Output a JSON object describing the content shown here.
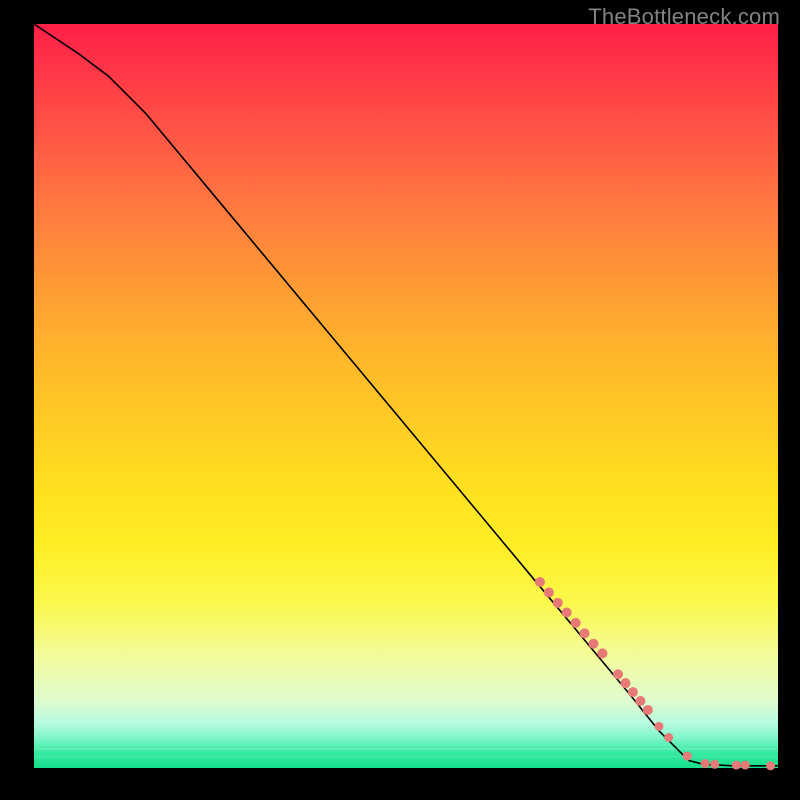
{
  "attribution": "TheBottleneck.com",
  "chart_data": {
    "type": "line",
    "title": "",
    "xlabel": "",
    "ylabel": "",
    "xlim": [
      0,
      100
    ],
    "ylim": [
      0,
      100
    ],
    "grid": false,
    "curve": {
      "name": "bottleneck-curve",
      "x": [
        0,
        3,
        6,
        10,
        15,
        20,
        25,
        30,
        35,
        40,
        45,
        50,
        55,
        60,
        65,
        70,
        75,
        80,
        84,
        88,
        90,
        92,
        94,
        96,
        98,
        100
      ],
      "y": [
        100,
        98,
        96,
        93,
        88,
        82,
        76,
        70,
        64,
        58,
        52,
        46,
        40,
        34,
        28,
        22,
        16,
        10,
        5,
        1,
        0.5,
        0.4,
        0.3,
        0.3,
        0.3,
        0.3
      ]
    },
    "marker_groups": [
      {
        "name": "highlight-segment-upper",
        "radius": 5.0,
        "points": [
          {
            "x": 68.0,
            "y": 25.0
          },
          {
            "x": 69.2,
            "y": 23.6
          },
          {
            "x": 70.4,
            "y": 22.2
          },
          {
            "x": 71.6,
            "y": 20.9
          },
          {
            "x": 72.8,
            "y": 19.5
          },
          {
            "x": 74.0,
            "y": 18.1
          },
          {
            "x": 75.2,
            "y": 16.7
          },
          {
            "x": 76.4,
            "y": 15.4
          }
        ]
      },
      {
        "name": "highlight-segment-lower",
        "radius": 5.0,
        "points": [
          {
            "x": 78.5,
            "y": 12.6
          },
          {
            "x": 79.5,
            "y": 11.4
          },
          {
            "x": 80.5,
            "y": 10.2
          },
          {
            "x": 81.5,
            "y": 9.0
          },
          {
            "x": 82.5,
            "y": 7.8
          }
        ]
      },
      {
        "name": "highlight-points-tail",
        "radius": 4.5,
        "points": [
          {
            "x": 84.0,
            "y": 5.6
          },
          {
            "x": 85.3,
            "y": 4.1
          },
          {
            "x": 87.8,
            "y": 1.6
          },
          {
            "x": 90.2,
            "y": 0.6
          },
          {
            "x": 91.5,
            "y": 0.5
          },
          {
            "x": 94.4,
            "y": 0.4
          },
          {
            "x": 95.6,
            "y": 0.4
          },
          {
            "x": 99.0,
            "y": 0.3
          }
        ]
      }
    ]
  }
}
